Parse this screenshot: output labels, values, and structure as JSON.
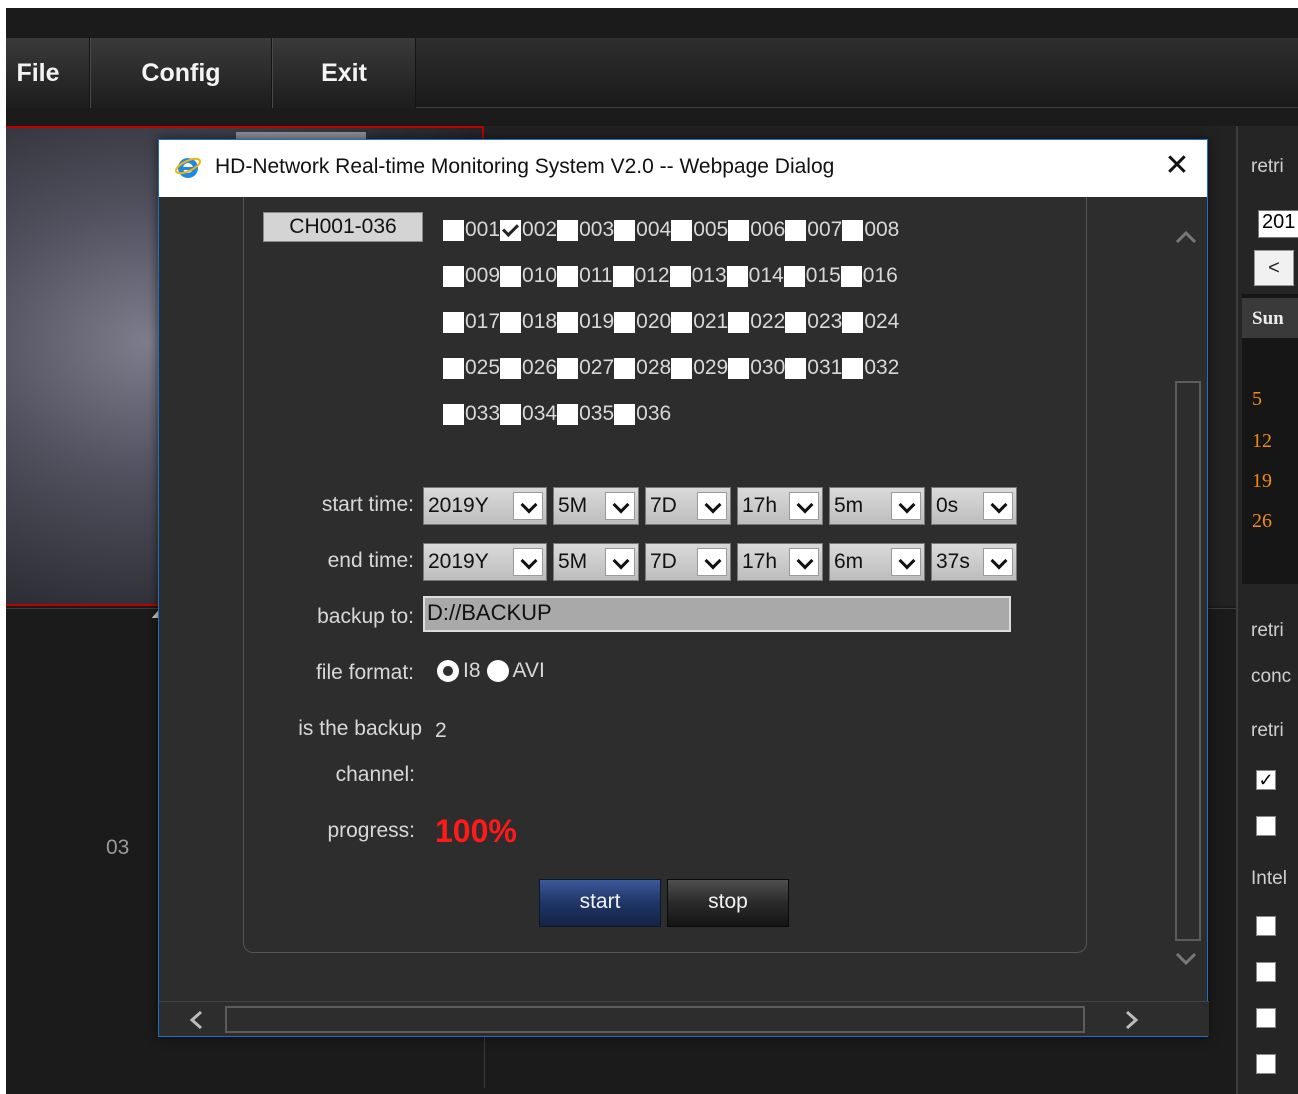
{
  "menu": {
    "file": "File",
    "config": "Config",
    "exit": "Exit"
  },
  "video": {
    "channel_label": "03"
  },
  "right_panel": {
    "retrieve_1": "retri",
    "year_fragment": "201",
    "prev": "<",
    "sun": "Sun",
    "days": [
      "5",
      "12",
      "19",
      "26"
    ],
    "retrieve_2": "retri",
    "condition": "conc",
    "retrieve_3": "retri",
    "intelligent": "Intel",
    "colors": {
      "day": "#f08a1a"
    }
  },
  "dialog": {
    "title": "HD-Network Real-time Monitoring System V2.0 -- Webpage Dialog",
    "close": "✕",
    "channel_group": "CH001-036",
    "channels": [
      [
        "001",
        "002",
        "003",
        "004",
        "005",
        "006",
        "007",
        "008"
      ],
      [
        "009",
        "010",
        "011",
        "012",
        "013",
        "014",
        "015",
        "016"
      ],
      [
        "017",
        "018",
        "019",
        "020",
        "021",
        "022",
        "023",
        "024"
      ],
      [
        "025",
        "026",
        "027",
        "028",
        "029",
        "030",
        "031",
        "032"
      ],
      [
        "033",
        "034",
        "035",
        "036"
      ]
    ],
    "checked_channels": [
      "002"
    ],
    "start_time_label": "start time:",
    "start_time": [
      "2019Y",
      "5M",
      "7D",
      "17h",
      "5m",
      "0s"
    ],
    "end_time_label": "end time:",
    "end_time": [
      "2019Y",
      "5M",
      "7D",
      "17h",
      "6m",
      "37s"
    ],
    "backup_to_label": "backup to:",
    "backup_to_value": "D://BACKUP",
    "file_format_label": "file format:",
    "file_format_options": [
      "I8",
      "AVI"
    ],
    "file_format_selected": "I8",
    "backup_channel_label_1": "is the backup",
    "backup_channel_label_2": "channel:",
    "backup_channel_value": "2",
    "progress_label": "progress:",
    "progress_value": "100%",
    "progress_fraction": 1.0,
    "start_button": "start",
    "stop_button": "stop",
    "colors": {
      "progress": "#ff1a1a",
      "title_bar": "#ffffff",
      "border": "#1e6fc8"
    }
  }
}
